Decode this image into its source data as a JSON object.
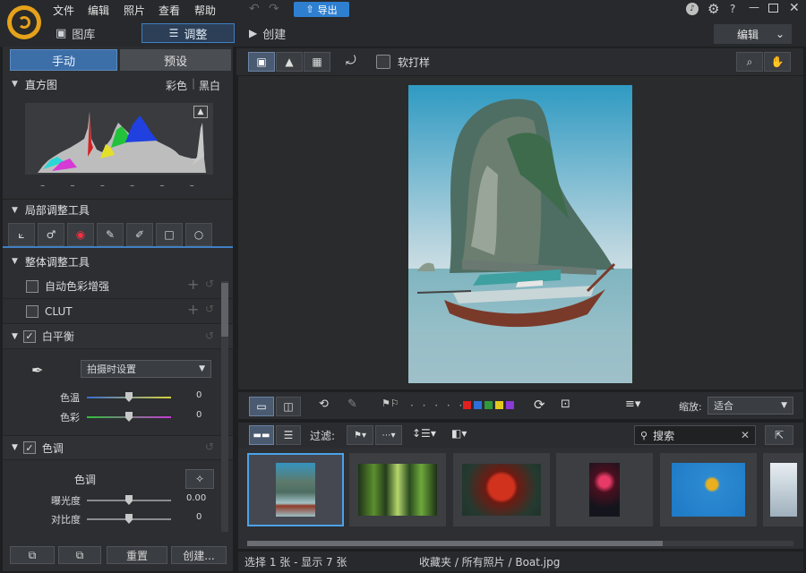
{
  "menu": [
    "文件",
    "编辑",
    "照片",
    "查看",
    "帮助"
  ],
  "export_label": "导出",
  "modes": {
    "library": "图库",
    "adjust": "调整",
    "create": "创建"
  },
  "edit_dropdown": "编辑",
  "window_controls": {
    "help": "?"
  },
  "tabs": {
    "manual": "手动",
    "preset": "预设"
  },
  "histogram": {
    "title": "直方图",
    "color": "彩色",
    "bw": "黑白",
    "ticks": [
      "–",
      "–",
      "–",
      "–",
      "–",
      "–"
    ]
  },
  "local_tools": {
    "title": "局部调整工具"
  },
  "global_tools": {
    "title": "整体调整工具"
  },
  "auto_color": "自动色彩增强",
  "clut": "CLUT",
  "white_balance": {
    "title": "白平衡",
    "preset": "拍摄时设置",
    "temp_label": "色温",
    "temp_value": "0",
    "tint_label": "色彩",
    "tint_value": "0"
  },
  "tone": {
    "title": "色调",
    "sub": "色调",
    "exposure_label": "曝光度",
    "exposure_value": "0.00",
    "contrast_label": "对比度",
    "contrast_value": "0"
  },
  "bottom": {
    "reset": "重置",
    "create": "创建..."
  },
  "viewbar": {
    "softproof": "软打样"
  },
  "stripbar": {
    "zoom_label": "缩放:",
    "zoom_value": "适合",
    "dots": "· · · · ·",
    "color_labels": [
      "#e02020",
      "#2f6fd8",
      "#2f9a3a",
      "#e3c81e",
      "#8a3ad6"
    ]
  },
  "filterbar": {
    "filter_label": "过滤:",
    "search_placeholder": "搜索"
  },
  "status": {
    "selection": "选择 1 张 - 显示 7 张",
    "path": "收藏夹 / 所有照片 / Boat.jpg"
  }
}
